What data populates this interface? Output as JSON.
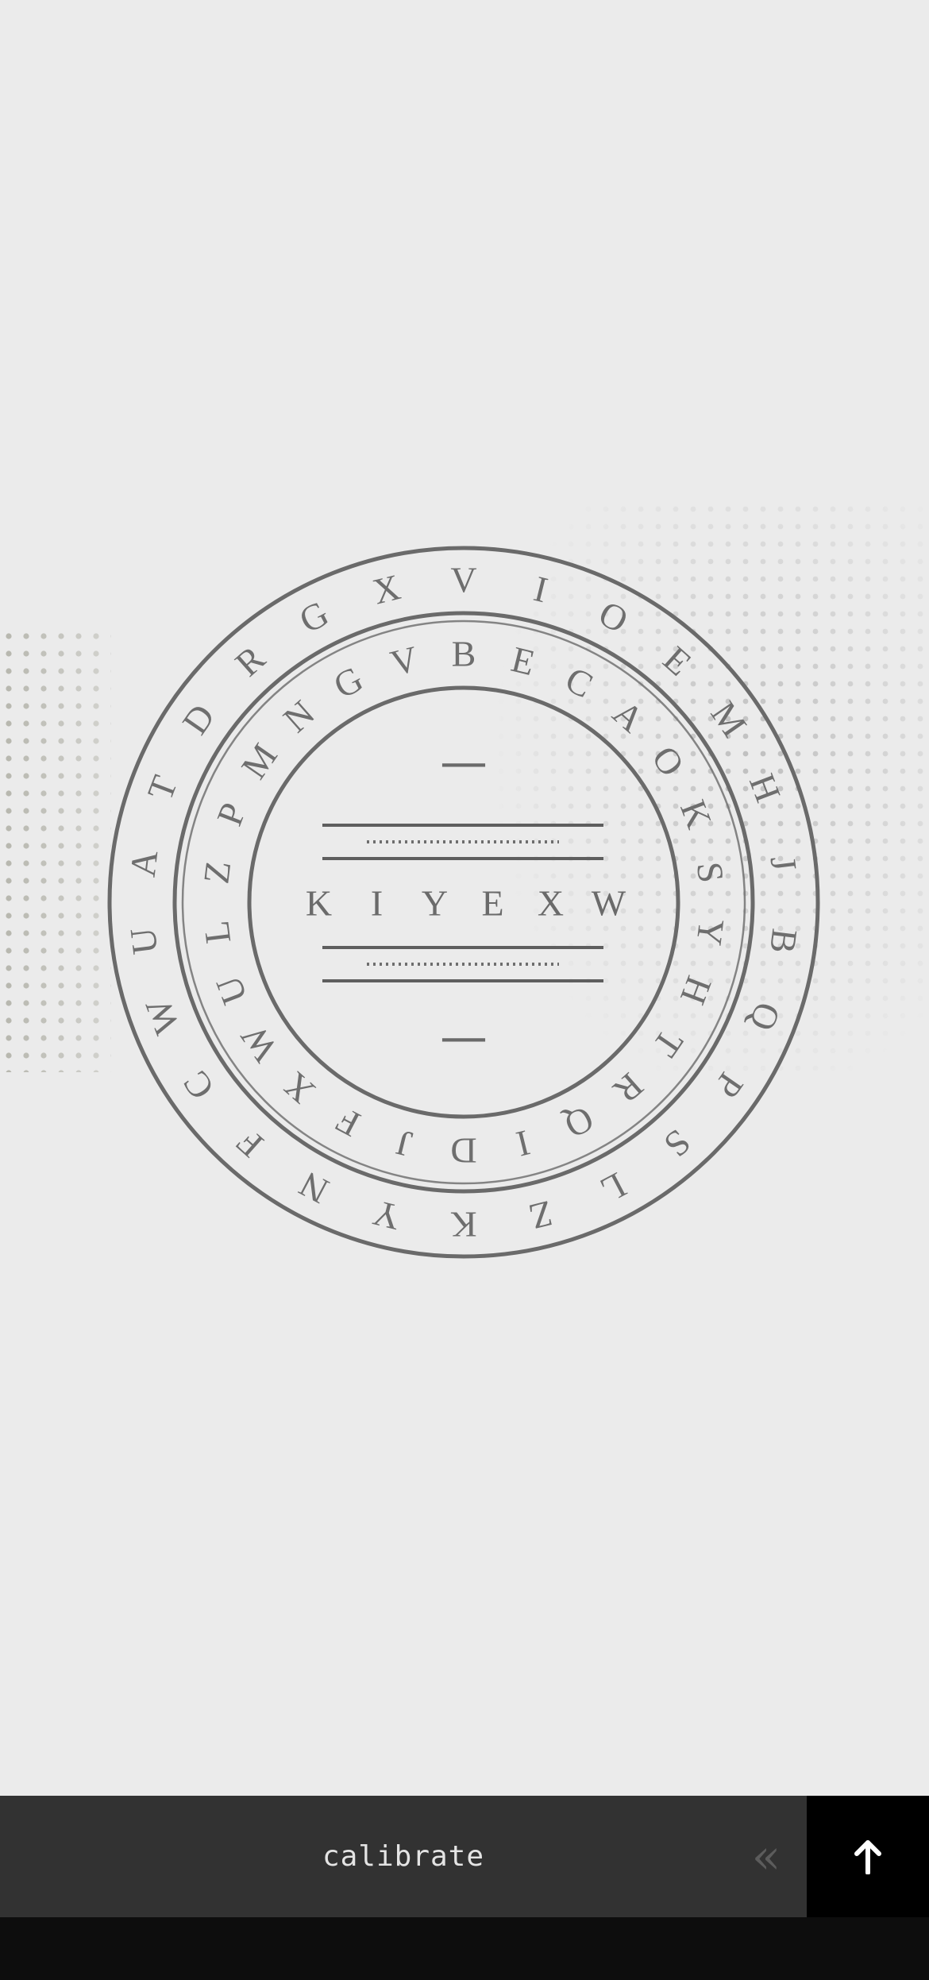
{
  "wheel": {
    "outer_ring": [
      "V",
      "I",
      "O",
      "E",
      "M",
      "H",
      "J",
      "B",
      "Q",
      "P",
      "S",
      "L",
      "Z",
      "K",
      "Y",
      "N",
      "F",
      "C",
      "W",
      "U",
      "A",
      "T",
      "D",
      "R",
      "G",
      "X"
    ],
    "inner_ring": [
      "B",
      "E",
      "C",
      "A",
      "O",
      "K",
      "S",
      "Y",
      "H",
      "T",
      "R",
      "Q",
      "I",
      "D",
      "J",
      "F",
      "X",
      "W",
      "U",
      "L",
      "Z",
      "P",
      "M",
      "N",
      "G",
      "V"
    ],
    "result_letters": [
      "K",
      "I",
      "Y",
      "E",
      "X",
      "W"
    ],
    "top_marker": "—",
    "bottom_marker": "—"
  },
  "toolbar": {
    "calibrate_label": "calibrate",
    "back_icon": "double-chevron-left-icon",
    "submit_icon": "arrow-up-icon"
  },
  "colors": {
    "background": "#ebebeb",
    "toolbar": "#323232",
    "submit_button": "#000000",
    "bottom_bar": "#0d0d0d",
    "ink": "#6e6e6e"
  }
}
